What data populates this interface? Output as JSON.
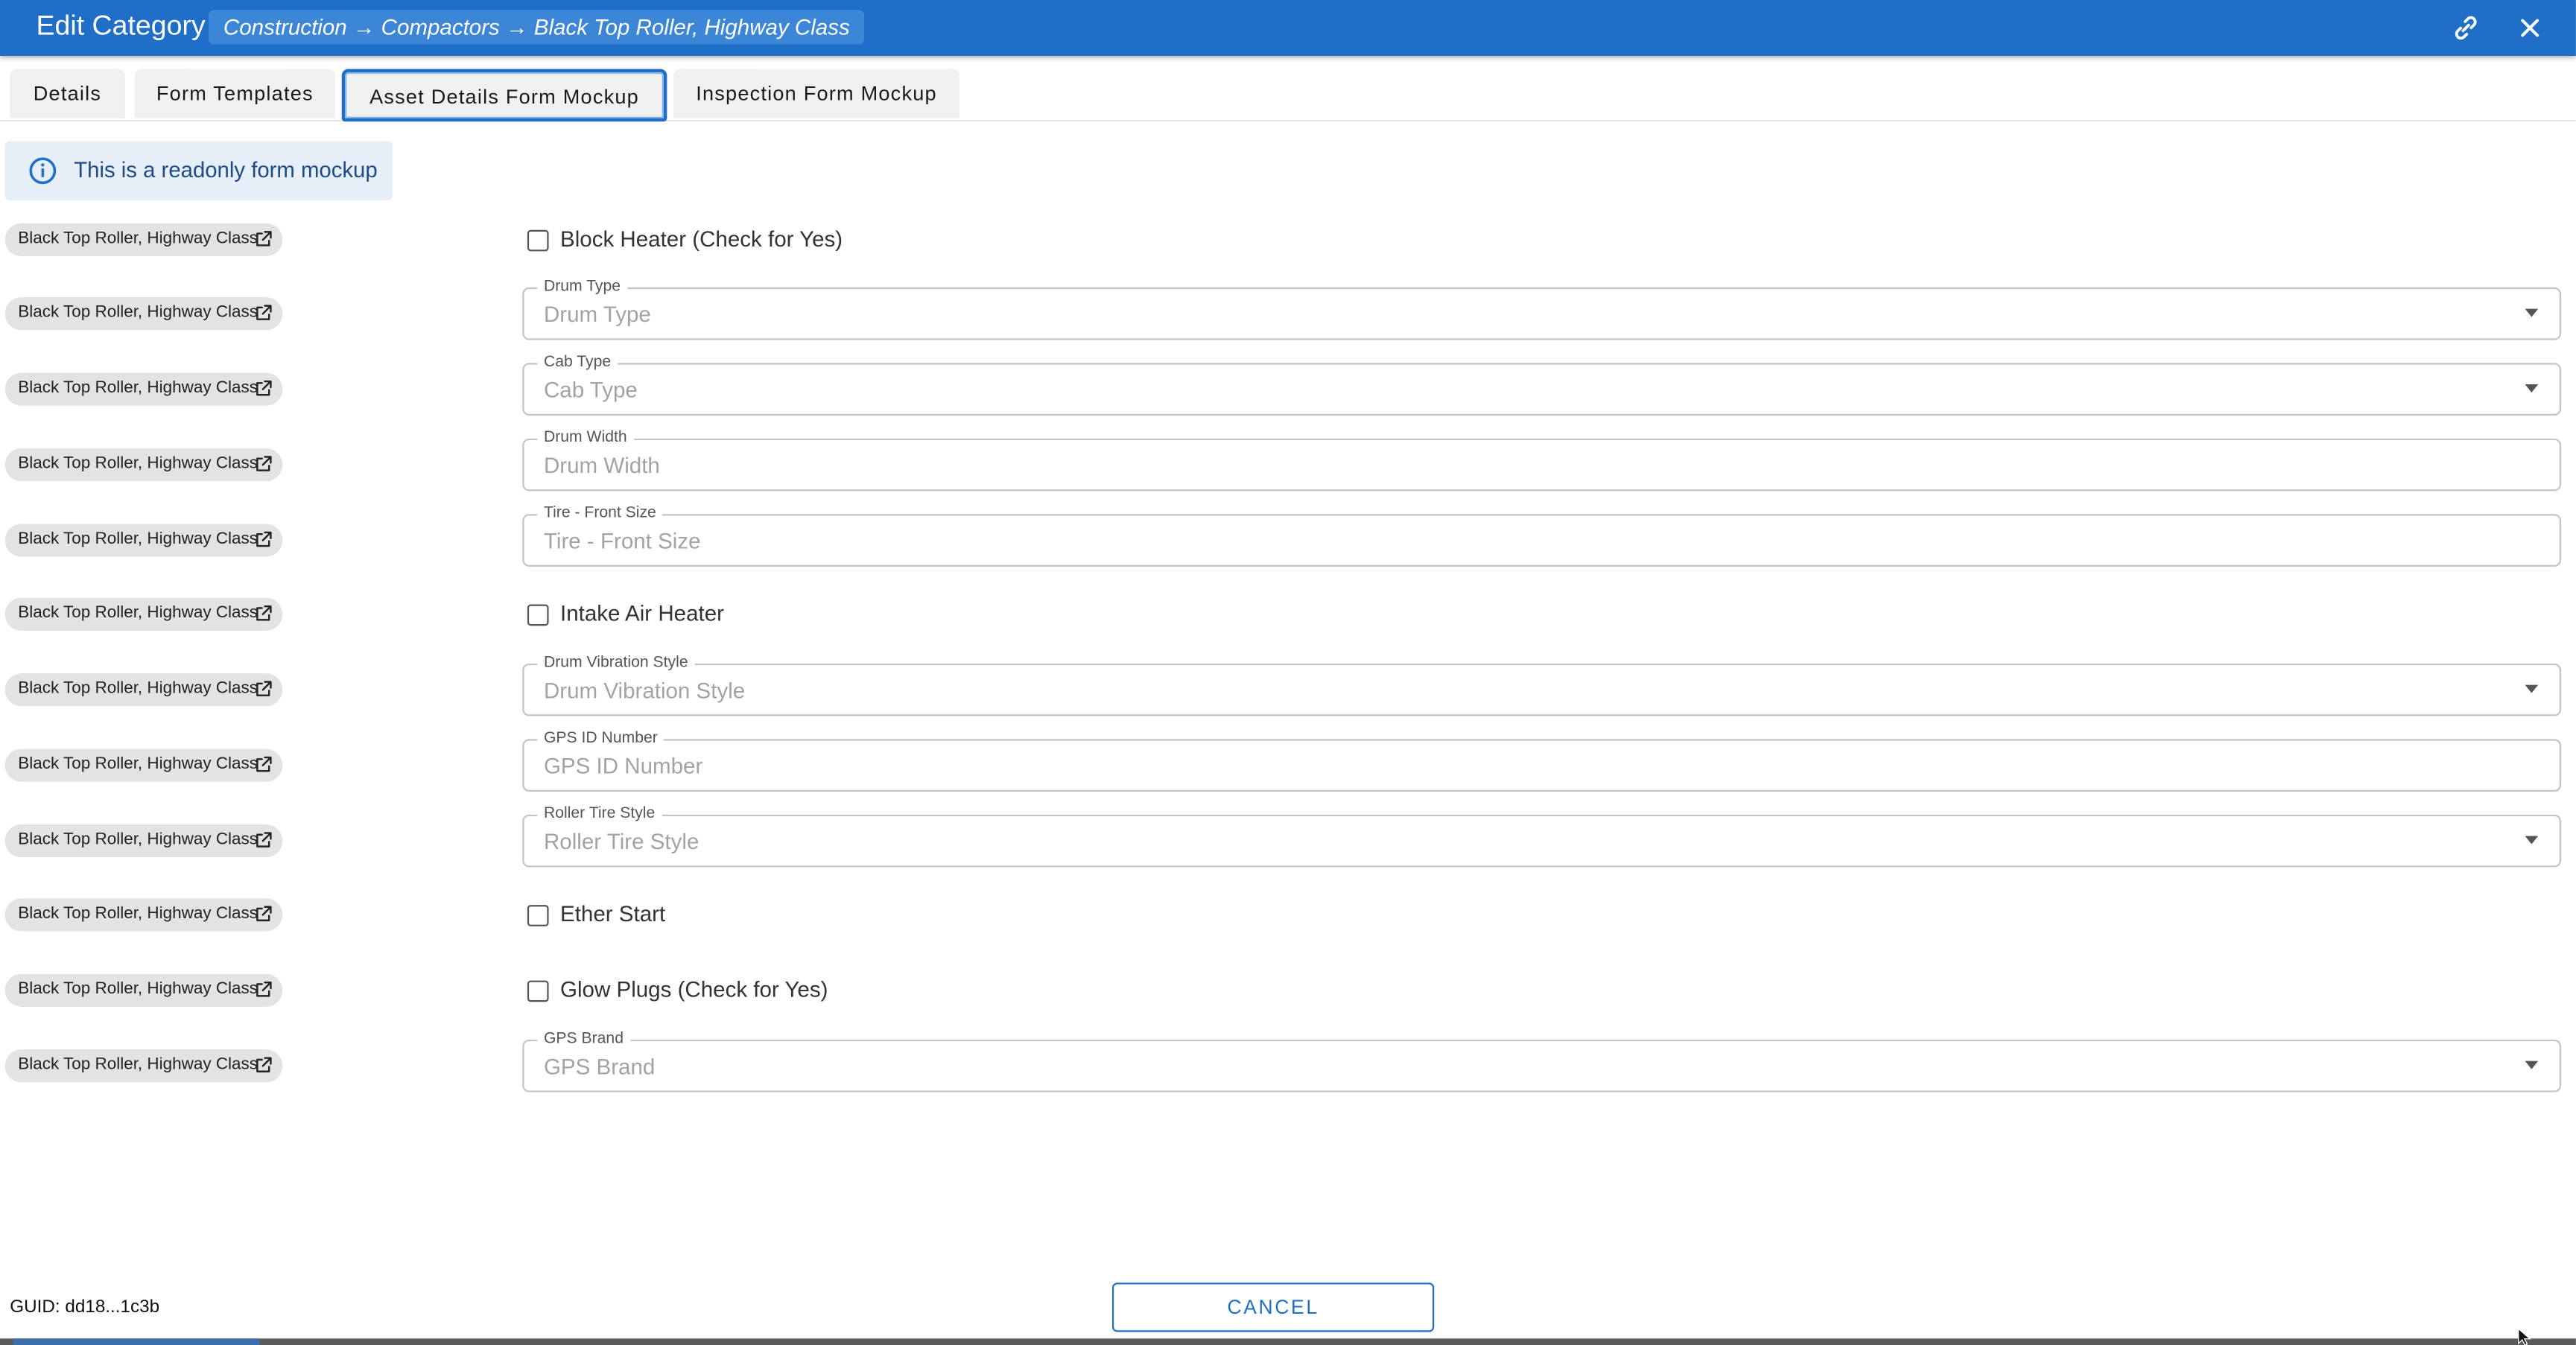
{
  "header": {
    "title": "Edit Category",
    "breadcrumb": "Construction → Compactors → Black Top Roller, Highway Class",
    "link_icon": "link-icon",
    "close_icon": "close-icon",
    "color": "#1f6fc8"
  },
  "tabs": [
    {
      "label": "Details",
      "active": false
    },
    {
      "label": "Form Templates",
      "active": false
    },
    {
      "label": "Asset Details Form Mockup",
      "active": true
    },
    {
      "label": "Inspection Form Mockup",
      "active": false
    }
  ],
  "alert": {
    "icon": "info-icon",
    "text": "This is a readonly form mockup"
  },
  "rows": [
    {
      "chip": "Black Top Roller, Highway Class",
      "kind": "checkbox",
      "label": "Block Heater (Check for Yes)"
    },
    {
      "chip": "Black Top Roller, Highway Class",
      "kind": "select",
      "label": "Drum Type",
      "placeholder": "Drum Type"
    },
    {
      "chip": "Black Top Roller, Highway Class",
      "kind": "select",
      "label": "Cab Type",
      "placeholder": "Cab Type"
    },
    {
      "chip": "Black Top Roller, Highway Class",
      "kind": "text",
      "label": "Drum Width",
      "placeholder": "Drum Width"
    },
    {
      "chip": "Black Top Roller, Highway Class",
      "kind": "text",
      "label": "Tire - Front Size",
      "placeholder": "Tire - Front Size"
    },
    {
      "chip": "Black Top Roller, Highway Class",
      "kind": "checkbox",
      "label": "Intake Air Heater"
    },
    {
      "chip": "Black Top Roller, Highway Class",
      "kind": "select",
      "label": "Drum Vibration Style",
      "placeholder": "Drum Vibration Style"
    },
    {
      "chip": "Black Top Roller, Highway Class",
      "kind": "text",
      "label": "GPS ID Number",
      "placeholder": "GPS ID Number"
    },
    {
      "chip": "Black Top Roller, Highway Class",
      "kind": "select",
      "label": "Roller Tire Style",
      "placeholder": "Roller Tire Style"
    },
    {
      "chip": "Black Top Roller, Highway Class",
      "kind": "checkbox",
      "label": "Ether Start"
    },
    {
      "chip": "Black Top Roller, Highway Class",
      "kind": "checkbox",
      "label": "Glow Plugs (Check for Yes)"
    },
    {
      "chip": "Black Top Roller, Highway Class",
      "kind": "select",
      "label": "GPS Brand",
      "placeholder": "GPS Brand"
    }
  ],
  "chip_icon": "open-in-new-icon",
  "footer": {
    "guid": "GUID: dd18...1c3b",
    "cancel_label": "CANCEL"
  }
}
